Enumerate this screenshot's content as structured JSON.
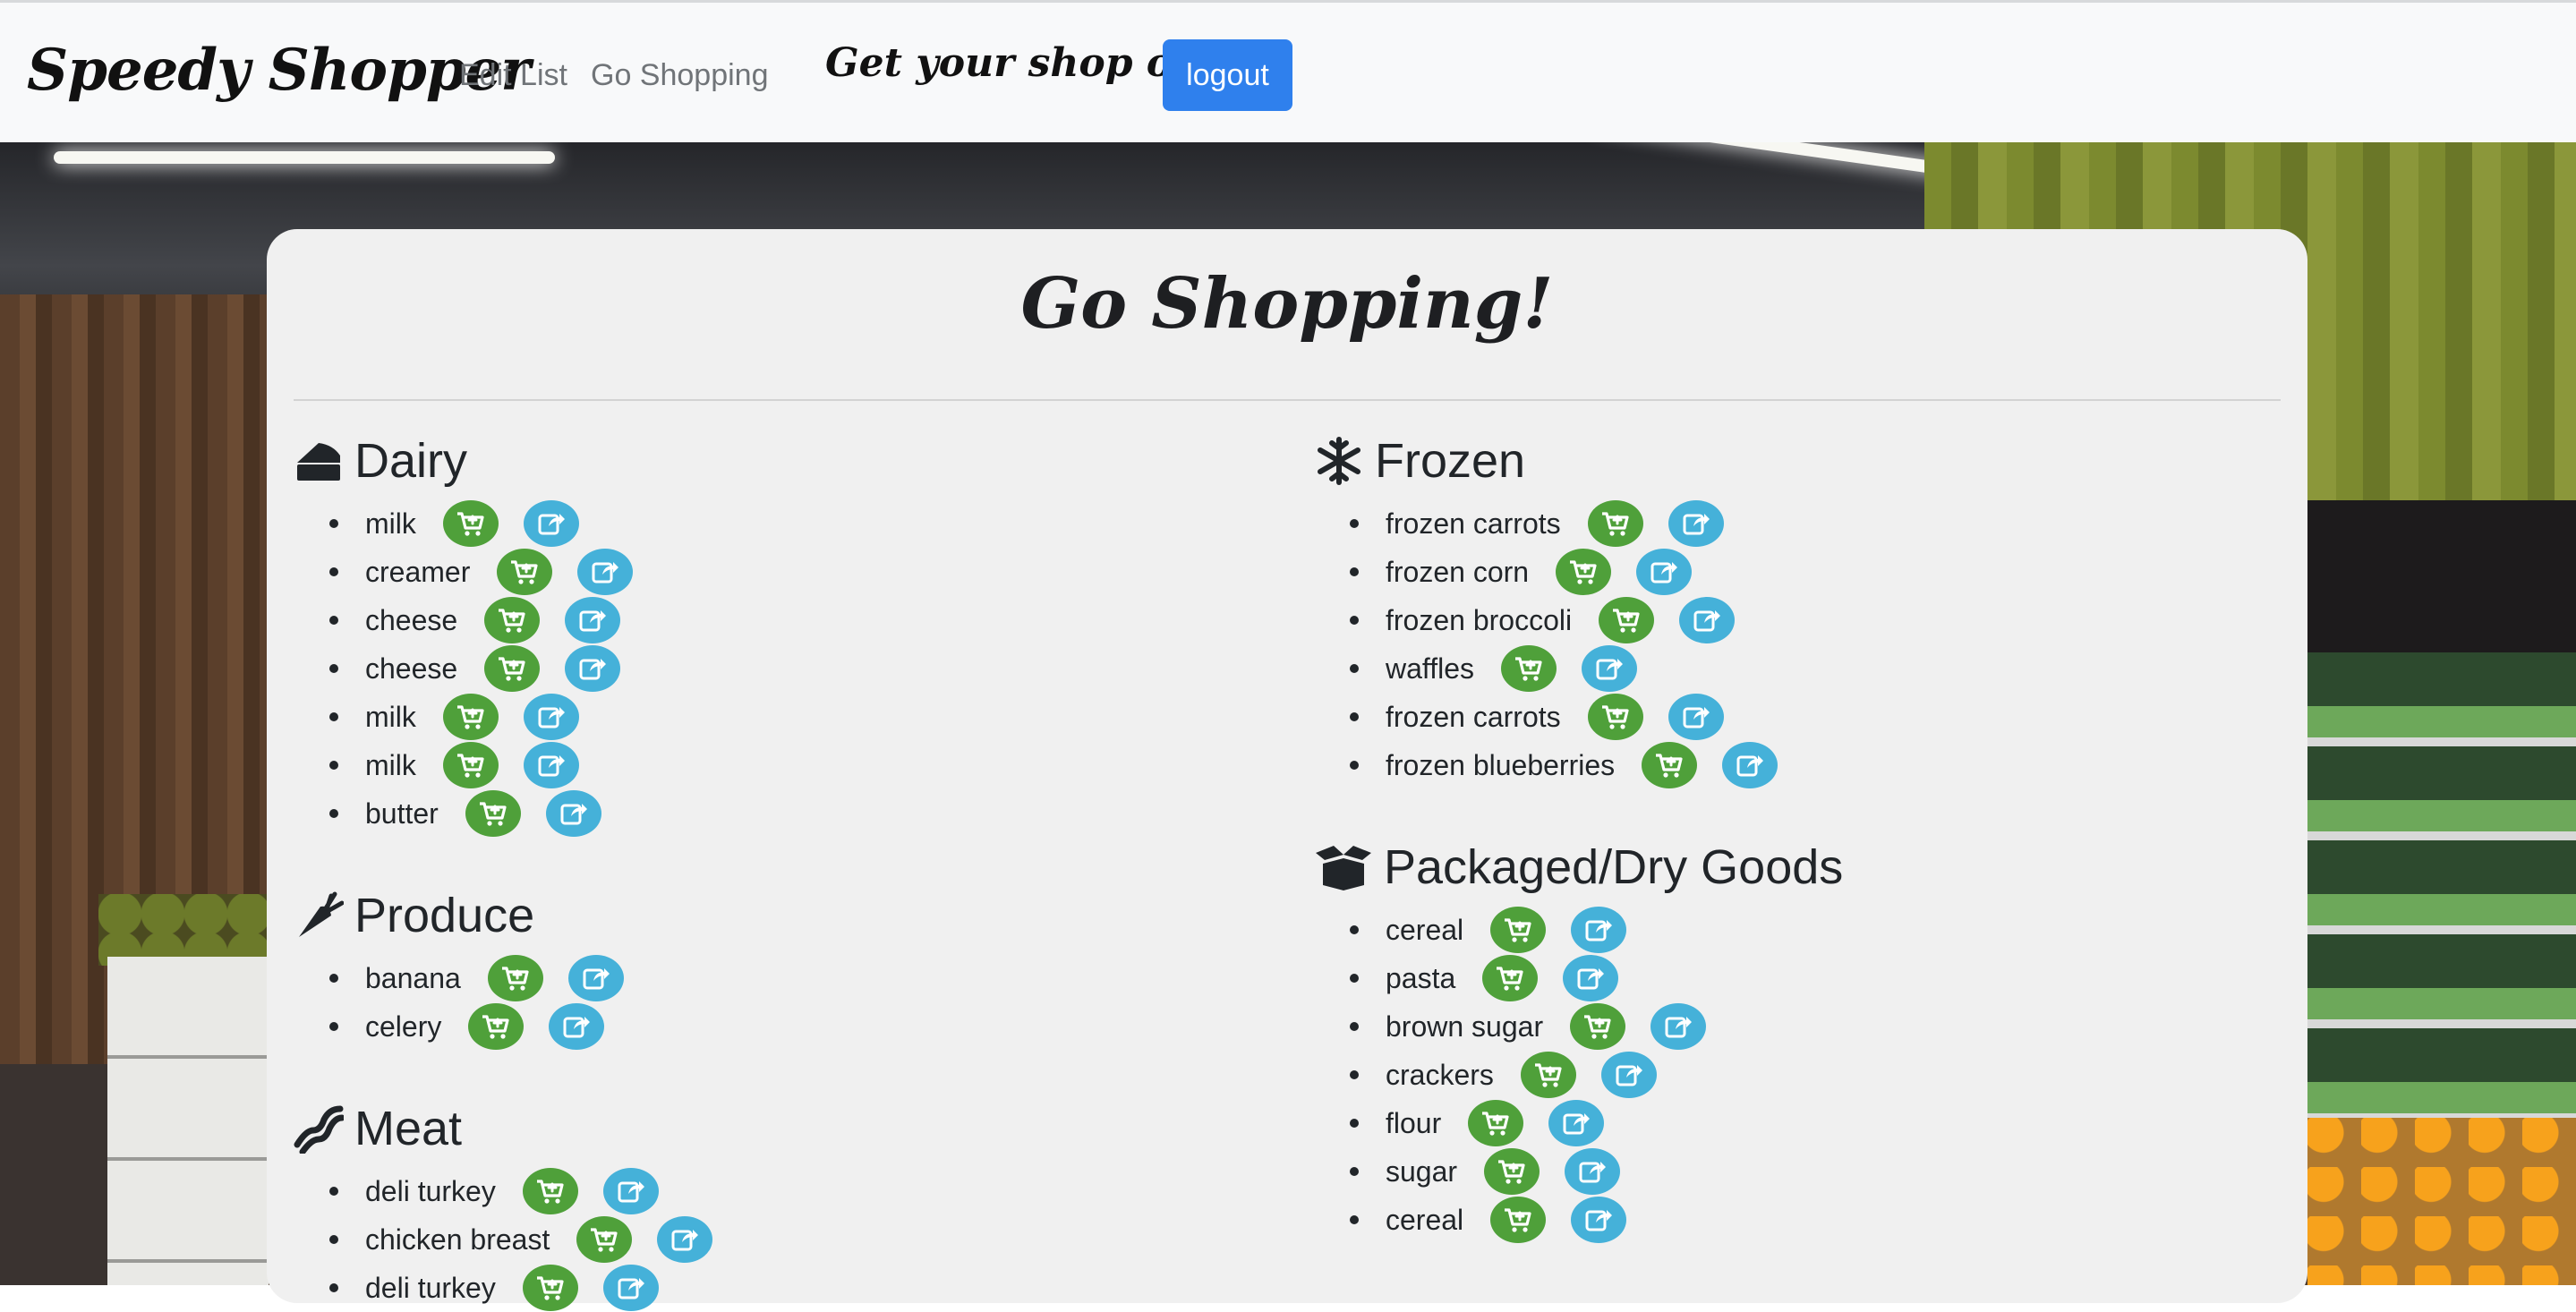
{
  "nav": {
    "brand": "Speedy Shopper",
    "links": [
      "Edit List",
      "Go Shopping"
    ],
    "tagline": "Get your shop on  !",
    "logout_label": "logout"
  },
  "page": {
    "title": "Go Shopping!"
  },
  "sections": {
    "dairy": {
      "title": "Dairy",
      "icon": "cheese-icon",
      "items": [
        "milk",
        "creamer",
        "cheese",
        "cheese",
        "milk",
        "milk",
        "butter"
      ]
    },
    "produce": {
      "title": "Produce",
      "icon": "carrot-icon",
      "items": [
        "banana",
        "celery"
      ]
    },
    "meat": {
      "title": "Meat",
      "icon": "bacon-icon",
      "items": [
        "deli turkey",
        "chicken breast",
        "deli turkey"
      ]
    },
    "frozen": {
      "title": "Frozen",
      "icon": "snowflake-icon",
      "items": [
        "frozen carrots",
        "frozen corn",
        "frozen broccoli",
        "waffles",
        "frozen carrots",
        "frozen blueberries"
      ]
    },
    "packaged": {
      "title": "Packaged/Dry Goods",
      "icon": "open-box-icon",
      "items": [
        "cereal",
        "pasta",
        "brown sugar",
        "crackers",
        "flour",
        "sugar",
        "cereal"
      ]
    }
  },
  "action_icons": {
    "cart": "cart-plus-icon",
    "share": "share-icon"
  },
  "colors": {
    "cart_button": "#4fa03a",
    "share_button": "#45b1d9",
    "logout_button": "#2f80ed",
    "card": "#f0f0f0"
  }
}
